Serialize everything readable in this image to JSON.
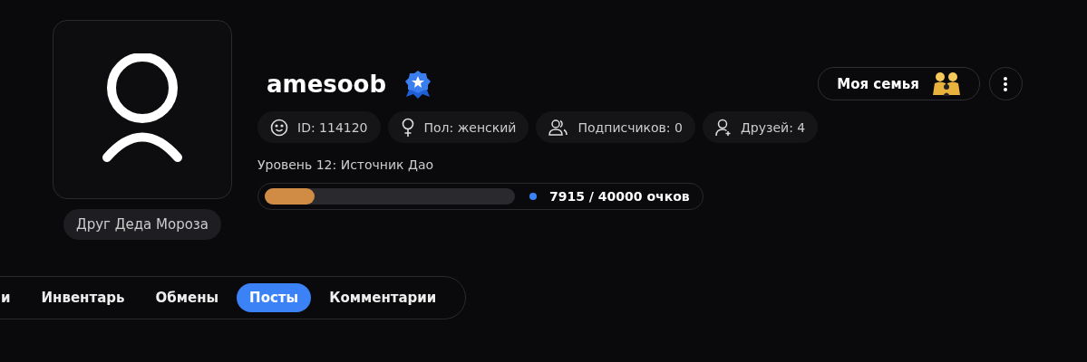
{
  "profile": {
    "username": "amesoob",
    "title_badge": "Друг Деда Мороза",
    "chips": [
      {
        "kind": "id",
        "label": "ID: 114120"
      },
      {
        "kind": "gender",
        "label": "Пол: женский"
      },
      {
        "kind": "followers",
        "label": "Подписчиков: 0"
      },
      {
        "kind": "friends",
        "label": "Друзей: 4"
      }
    ],
    "level_title": "Уровень 12: Источник Дао",
    "progress": {
      "level": 0.2,
      "reading": "7915 / 40000 очков"
    },
    "family_button": "Моя семья"
  },
  "tabs": [
    {
      "label": "и",
      "selected": false
    },
    {
      "label": "Инвентарь",
      "selected": false
    },
    {
      "label": "Обмены",
      "selected": false
    },
    {
      "label": "Посты",
      "selected": true
    },
    {
      "label": "Комментарии",
      "selected": false
    }
  ]
}
